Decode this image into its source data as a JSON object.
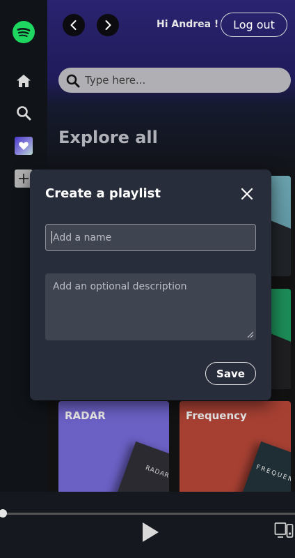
{
  "header": {
    "greeting": "Hi Andrea !",
    "logout_label": "Log out"
  },
  "search": {
    "placeholder": "Type here..."
  },
  "browse": {
    "title": "Explore all",
    "tiles": [
      {
        "label": "",
        "color": "#6fa8b3"
      },
      {
        "label": "",
        "color": "#1c8c57"
      },
      {
        "label": "RADAR",
        "cover_text": "RADAR",
        "color": "#6b60c4"
      },
      {
        "label": "Frequency",
        "cover_text": "FREQUENCY",
        "color": "#a64033"
      }
    ]
  },
  "sidebar": {
    "items": [
      {
        "icon": "spotify-logo-icon"
      },
      {
        "icon": "home-icon"
      },
      {
        "icon": "search-icon"
      },
      {
        "icon": "liked-songs-heart-icon"
      },
      {
        "icon": "plus-icon"
      }
    ]
  },
  "modal": {
    "title": "Create a playlist",
    "name_placeholder": "Add a name",
    "name_value": "",
    "description_placeholder": "Add an optional description",
    "save_label": "Save"
  },
  "player": {
    "progress": 0.0
  },
  "colors": {
    "brand_green": "#1ed760",
    "modal_bg": "#272d3a",
    "sidebar_bg": "#101419",
    "header_gradient": "#2a2370"
  }
}
